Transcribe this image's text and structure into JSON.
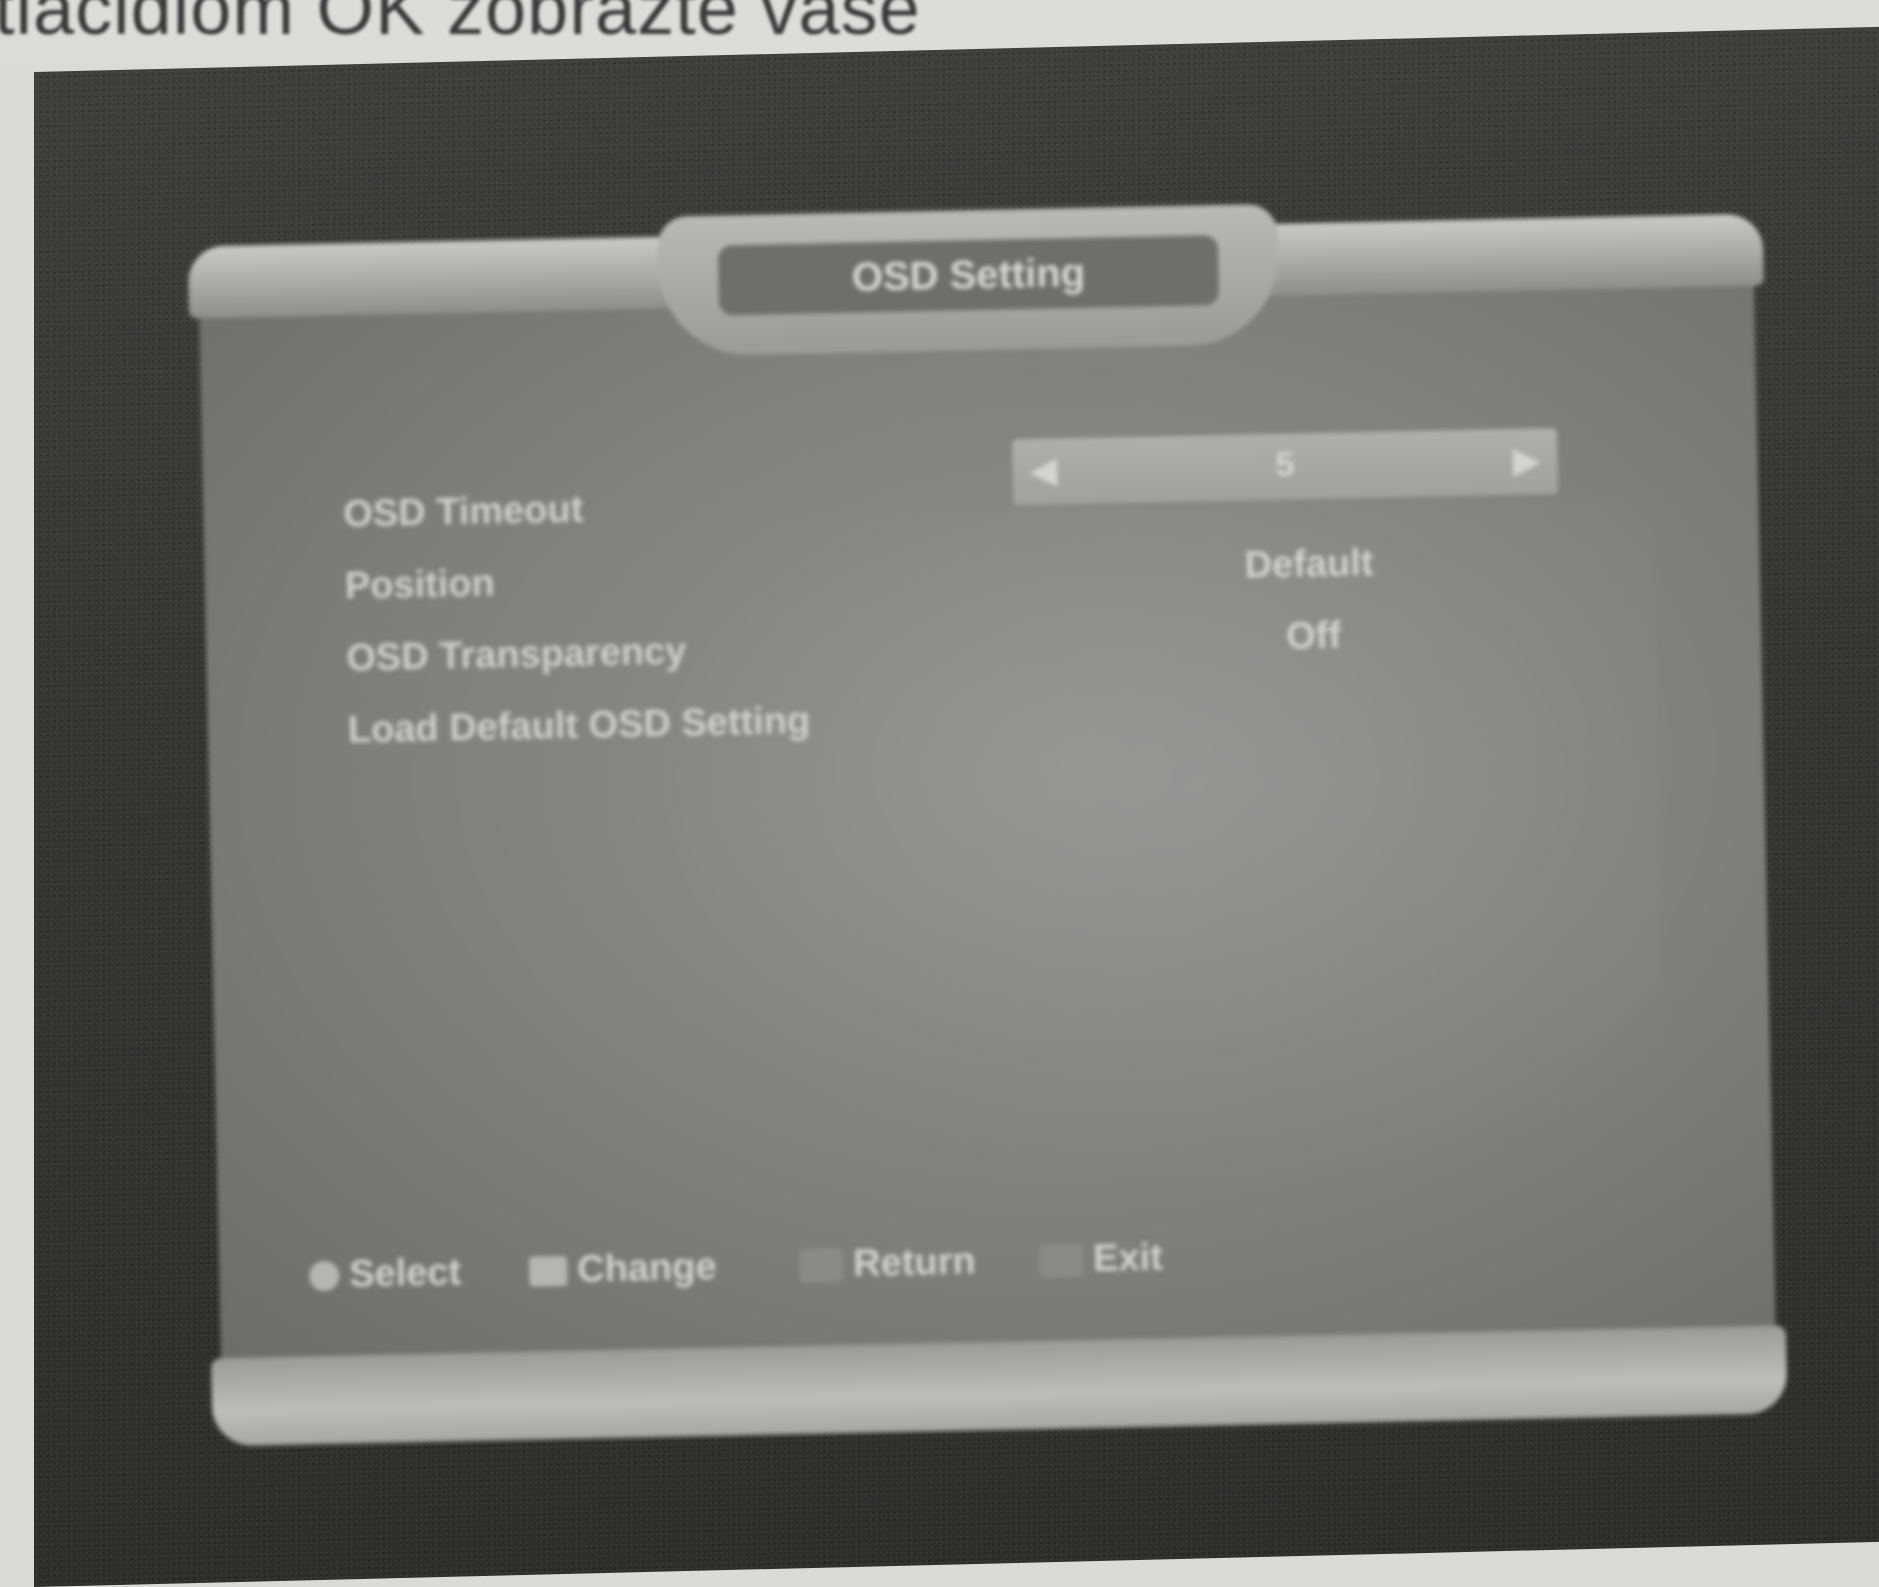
{
  "page_header": {
    "text": "tlačidlom OK zobrazte vaše"
  },
  "osd": {
    "title": "OSD Setting",
    "settings": [
      {
        "label": "OSD Timeout"
      },
      {
        "label": "Position"
      },
      {
        "label": "OSD Transparency"
      },
      {
        "label": "Load Default OSD Setting"
      }
    ],
    "selector": {
      "value": "5",
      "left_arrow": "◀",
      "right_arrow": "▶"
    },
    "values": {
      "position": "Default",
      "transparency": "Off"
    },
    "help": {
      "select": "Select",
      "change": "Change",
      "return": "Return",
      "exit": "Exit"
    }
  }
}
